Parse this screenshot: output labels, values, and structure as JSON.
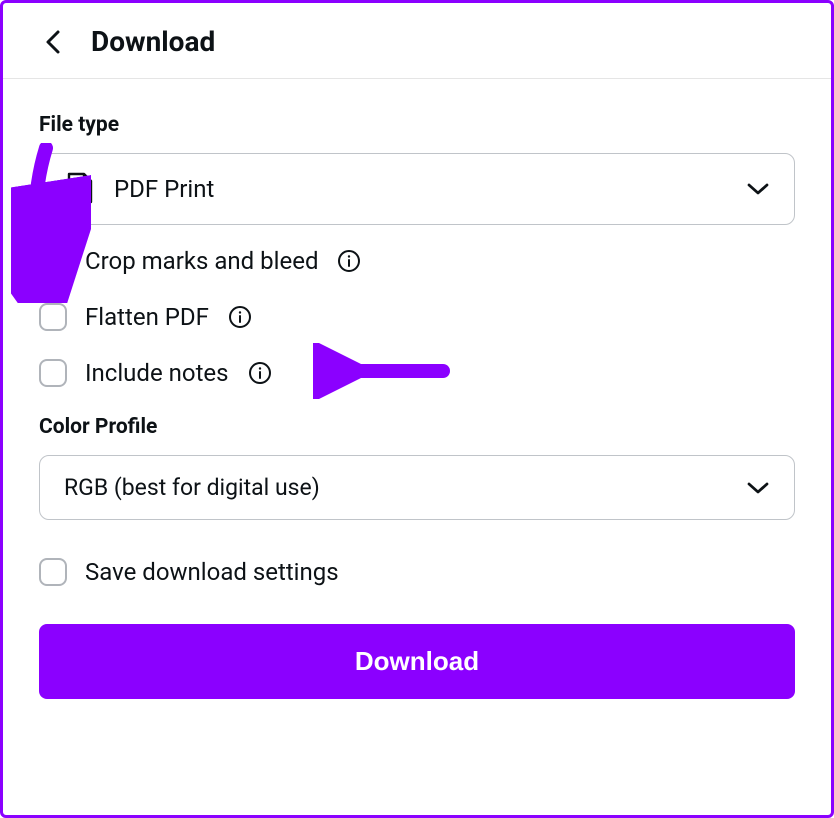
{
  "header": {
    "title": "Download"
  },
  "file_type": {
    "section_label": "File type",
    "selected": "PDF Print"
  },
  "options": {
    "crop_marks": "Crop marks and bleed",
    "flatten": "Flatten PDF",
    "include_notes": "Include notes"
  },
  "color_profile": {
    "section_label": "Color Profile",
    "selected": "RGB (best for digital use)"
  },
  "save_settings": "Save download settings",
  "download_button": "Download",
  "colors": {
    "accent": "#8b00ff"
  }
}
